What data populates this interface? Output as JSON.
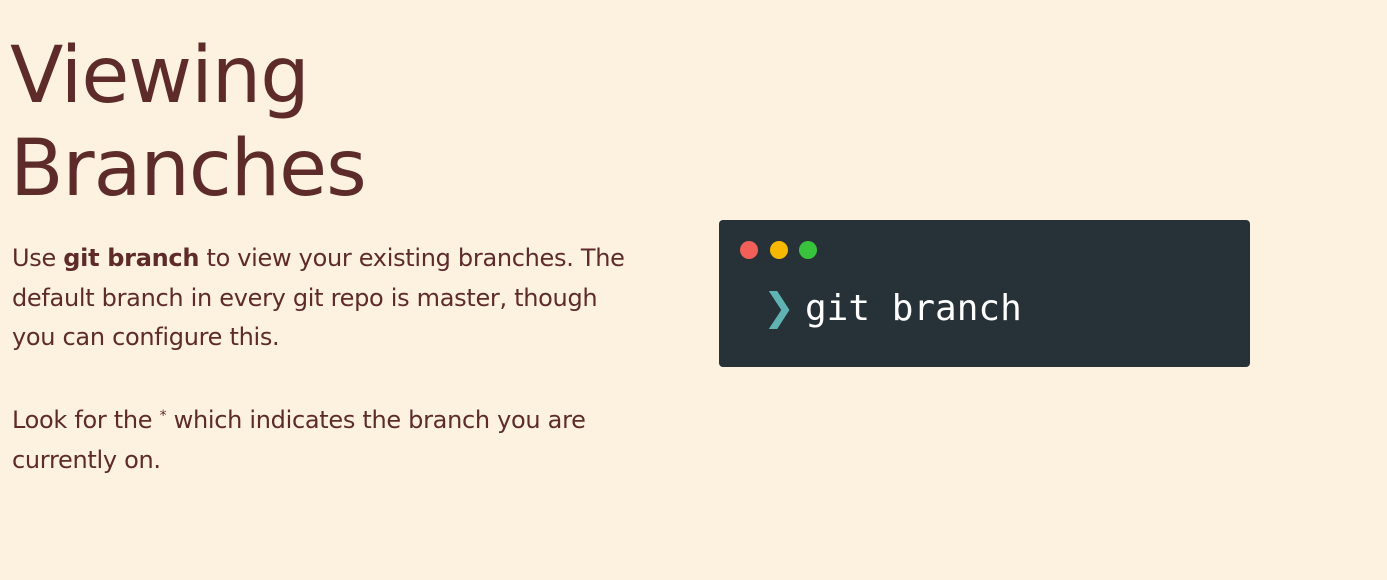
{
  "slide": {
    "title_line1": "Viewing",
    "title_line2": "Branches",
    "paragraph1": {
      "prefix": "Use ",
      "command": "git branch",
      "suffix": " to view your existing branches. The default branch in every git repo is master, though you can configure this."
    },
    "paragraph2": {
      "prefix": "Look for the ",
      "asterisk": "*",
      "suffix": " which indicates the branch you are currently on."
    }
  },
  "terminal": {
    "prompt_symbol": "❯",
    "command": "git branch"
  },
  "colors": {
    "background": "#fdf1e0",
    "text": "#5e2b2b",
    "terminal_bg": "#263238",
    "prompt": "#5fb3b3",
    "dot_red": "#f25f58",
    "dot_yellow": "#f7b900",
    "dot_green": "#39c33d"
  }
}
